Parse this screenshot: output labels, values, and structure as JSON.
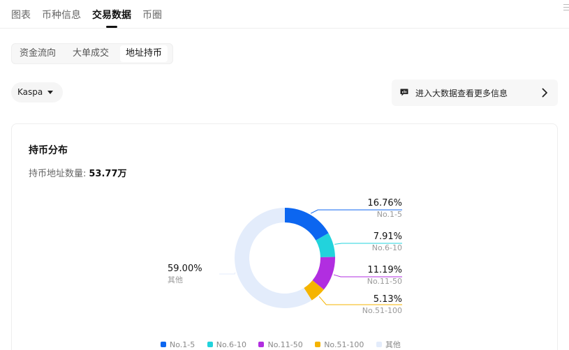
{
  "top_tabs": [
    {
      "label": "图表",
      "active": false
    },
    {
      "label": "币种信息",
      "active": false
    },
    {
      "label": "交易数据",
      "active": true
    },
    {
      "label": "币圈",
      "active": false
    }
  ],
  "sub_tabs": [
    {
      "label": "资金流向",
      "active": false
    },
    {
      "label": "大单成交",
      "active": false
    },
    {
      "label": "地址持币",
      "active": true
    }
  ],
  "coin_selector": {
    "value": "Kaspa"
  },
  "big_data_link": {
    "label": "进入大数据查看更多信息"
  },
  "card": {
    "title": "持币分布",
    "address_label": "持币地址数量:",
    "address_value": "53.77万"
  },
  "colors": {
    "no1_5": "#0c66f0",
    "no6_10": "#22d3dc",
    "no11_50": "#b12ee0",
    "no51_100": "#f5b400",
    "other": "#e3ecfb",
    "text_muted": "#999999"
  },
  "chart_data": {
    "type": "pie",
    "categories": [
      "No.1-5",
      "No.6-10",
      "No.11-50",
      "No.51-100",
      "其他"
    ],
    "values": [
      16.76,
      7.91,
      11.19,
      5.13,
      59.0
    ],
    "value_labels": [
      "16.76%",
      "7.91%",
      "11.19%",
      "5.13%",
      "59.00%"
    ],
    "unit": "%",
    "legend_position": "bottom"
  }
}
